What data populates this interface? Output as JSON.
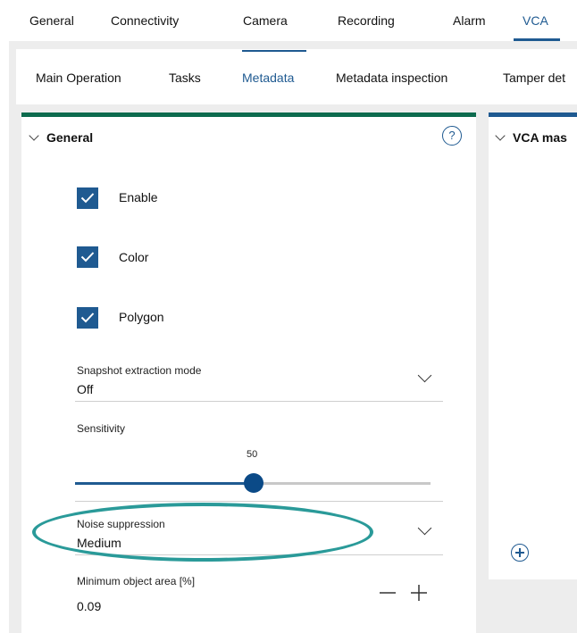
{
  "top_nav": {
    "items": [
      "General",
      "Connectivity",
      "Camera",
      "Recording",
      "Alarm",
      "VCA"
    ],
    "active": "VCA"
  },
  "sub_tabs": {
    "items": [
      "Main Operation",
      "Tasks",
      "Metadata",
      "Metadata inspection",
      "Tamper det"
    ],
    "active": "Metadata"
  },
  "general_panel": {
    "title": "General",
    "help_icon": "?",
    "checkboxes": [
      {
        "label": "Enable",
        "checked": true
      },
      {
        "label": "Color",
        "checked": true
      },
      {
        "label": "Polygon",
        "checked": true
      }
    ],
    "snapshot_extraction": {
      "label": "Snapshot extraction mode",
      "value": "Off"
    },
    "sensitivity": {
      "label": "Sensitivity",
      "value": "50"
    },
    "noise_suppression": {
      "label": "Noise suppression",
      "value": "Medium"
    },
    "min_object_area": {
      "label": "Minimum object area [%]",
      "value": "0.09"
    }
  },
  "vca_panel": {
    "title": "VCA mas"
  },
  "colors": {
    "accent": "#1f5a91",
    "general_bar": "#0d6b4e",
    "highlight": "#2a9a99"
  }
}
